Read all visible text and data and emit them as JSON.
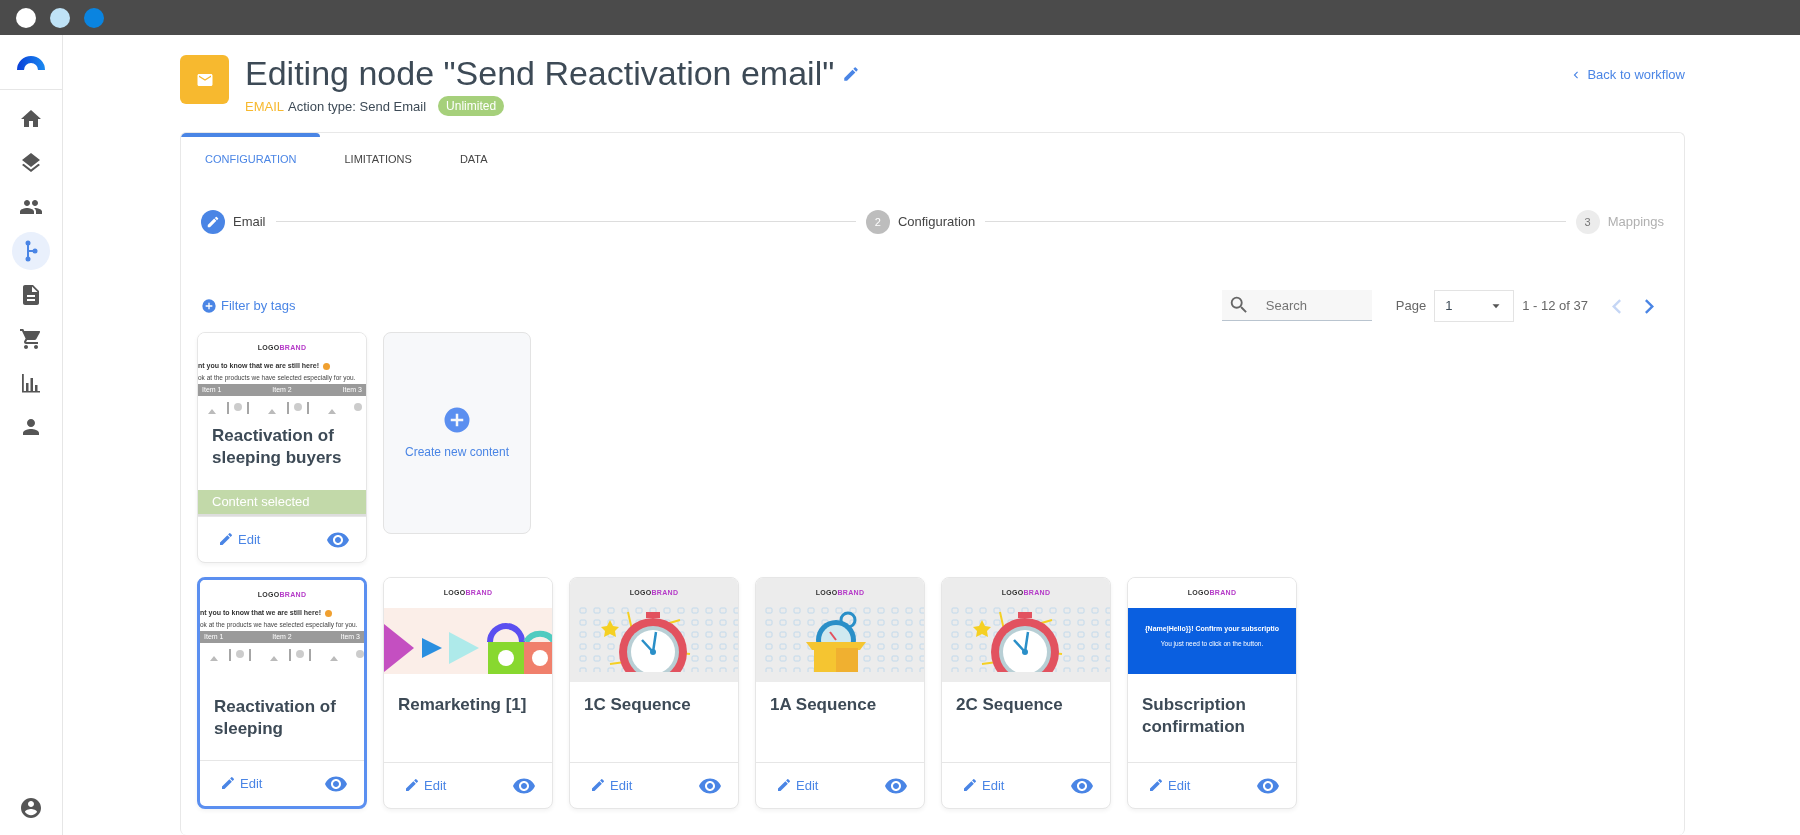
{
  "window": {
    "controls": [
      {
        "color": "#ffffff"
      },
      {
        "color": "#bfe3f7"
      },
      {
        "color": "#0a84e0"
      }
    ]
  },
  "sidebar": {
    "items": [
      {
        "kind": "home",
        "selected": false
      },
      {
        "kind": "layers",
        "selected": false
      },
      {
        "kind": "people",
        "selected": false
      },
      {
        "kind": "workflow",
        "selected": true
      },
      {
        "kind": "document",
        "selected": false
      },
      {
        "kind": "cart",
        "selected": false
      },
      {
        "kind": "chart",
        "selected": false
      },
      {
        "kind": "person",
        "selected": false
      }
    ]
  },
  "header": {
    "title": "Editing node \"Send Reactivation email\"",
    "channel": "EMAIL",
    "action_type": "Action type: Send Email",
    "badge": "Unlimited",
    "back_link": "Back to workflow"
  },
  "tabs": [
    {
      "label": "CONFIGURATION",
      "selected": true
    },
    {
      "label": "LIMITATIONS",
      "selected": false
    },
    {
      "label": "DATA",
      "selected": false
    }
  ],
  "steps": [
    {
      "kind": "edit",
      "label": "Email",
      "disabled": false
    },
    {
      "kind": "number",
      "number": "2",
      "label": "Configuration",
      "disabled": false
    },
    {
      "kind": "number",
      "number": "3",
      "label": "Mappings",
      "disabled": true
    }
  ],
  "toolbar": {
    "filter": "Filter by tags",
    "search_placeholder": "Search",
    "page_label": "Page",
    "page": "1",
    "range": "1 - 12 of 37",
    "prev_disabled": true,
    "next_disabled": false
  },
  "create_tile": {
    "label": "Create new content"
  },
  "contents": [
    {
      "title": "Reactivation of sleeping buyers",
      "selected": false,
      "status": "Content selected",
      "edit": "Edit",
      "preview": {
        "kind": "reactivation",
        "logo": "LOGO",
        "logo_accent": "BRAND",
        "headline": "nt you to know that we are still here!",
        "subtext": "ok at the products we have selected especially for you.",
        "items": [
          "Item 1",
          "Item 2",
          "Item 3"
        ]
      }
    },
    {
      "title": "Reactivation of sleeping",
      "selected": true,
      "edit": "Edit",
      "preview": {
        "kind": "reactivation",
        "logo": "LOGO",
        "logo_accent": "BRAND",
        "headline": "nt you to know that we are still here!",
        "subtext": "ok at the products we have selected especially for you.",
        "items": [
          "Item 1",
          "Item 2",
          "Item 3"
        ]
      }
    },
    {
      "title": "Remarketing [1]",
      "selected": false,
      "edit": "Edit",
      "preview": {
        "kind": "shapes",
        "logo": "LOGO",
        "logo_accent": "BRAND"
      }
    },
    {
      "title": "1C Sequence",
      "selected": false,
      "edit": "Edit",
      "preview": {
        "kind": "stopwatch",
        "logo": "LOGO",
        "logo_accent": "BRAND"
      }
    },
    {
      "title": "1A Sequence",
      "selected": false,
      "edit": "Edit",
      "preview": {
        "kind": "box",
        "logo": "LOGO",
        "logo_accent": "BRAND"
      }
    },
    {
      "title": "2C Sequence",
      "selected": false,
      "edit": "Edit",
      "preview": {
        "kind": "stopwatch",
        "logo": "LOGO",
        "logo_accent": "BRAND"
      }
    },
    {
      "title": "Subscription confirmation",
      "selected": false,
      "edit": "Edit",
      "preview": {
        "kind": "confirmation",
        "logo": "LOGO",
        "logo_accent": "BRAND",
        "headline": "{Name|Hello}}! Confirm your subscriptio",
        "subtext": "You just need to click on the button."
      }
    }
  ]
}
